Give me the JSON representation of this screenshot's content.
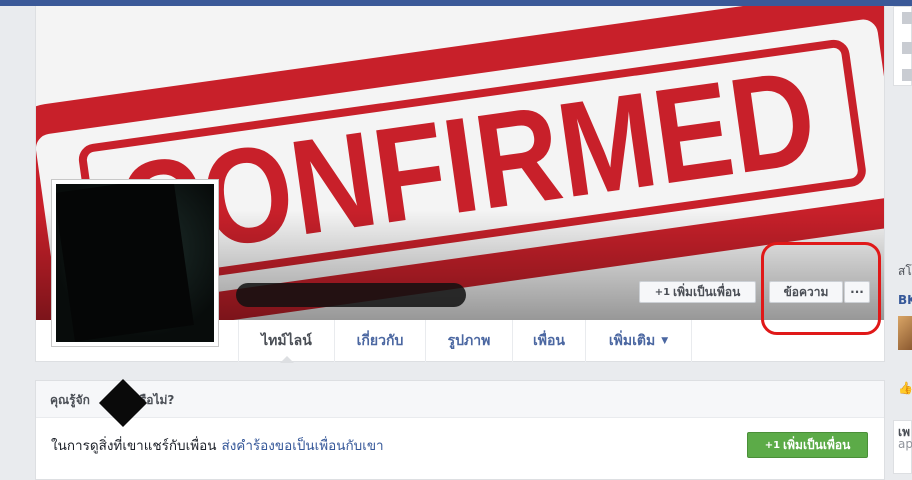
{
  "cover": {
    "stamp_text": "CONFIRMED",
    "stamp_color": "#c8202a"
  },
  "profile": {
    "add_friend_label": "เพิ่มเป็นเพื่อน",
    "add_friend_icon": "+1",
    "message_label": "ข้อความ",
    "more_label": "···"
  },
  "tabs": [
    {
      "label": "ไทม์ไลน์"
    },
    {
      "label": "เกี่ยวกับ"
    },
    {
      "label": "รูปภาพ"
    },
    {
      "label": "เพื่อน"
    },
    {
      "label": "เพิ่มเติม",
      "dropdown": "▼"
    }
  ],
  "know_card": {
    "title_prefix": "คุณรู้จัก",
    "title_suffix": "หรือไม่?",
    "body_text": "ในการดูสิ่งที่เขาแชร์กับเพื่อน",
    "body_link": "ส่งคำร้องขอเป็นเพื่อนกับเขา",
    "button_icon": "+1",
    "button_label": "เพิ่มเป็นเพื่อน"
  },
  "right_column": {
    "label_1": "สโ",
    "label_2": "BK",
    "label_3": "เพ",
    "label_4": "ap"
  },
  "colors": {
    "facebook_blue": "#3b5998",
    "link": "#365899",
    "green_button": "#5cab48",
    "highlight_circle": "#e01818"
  }
}
